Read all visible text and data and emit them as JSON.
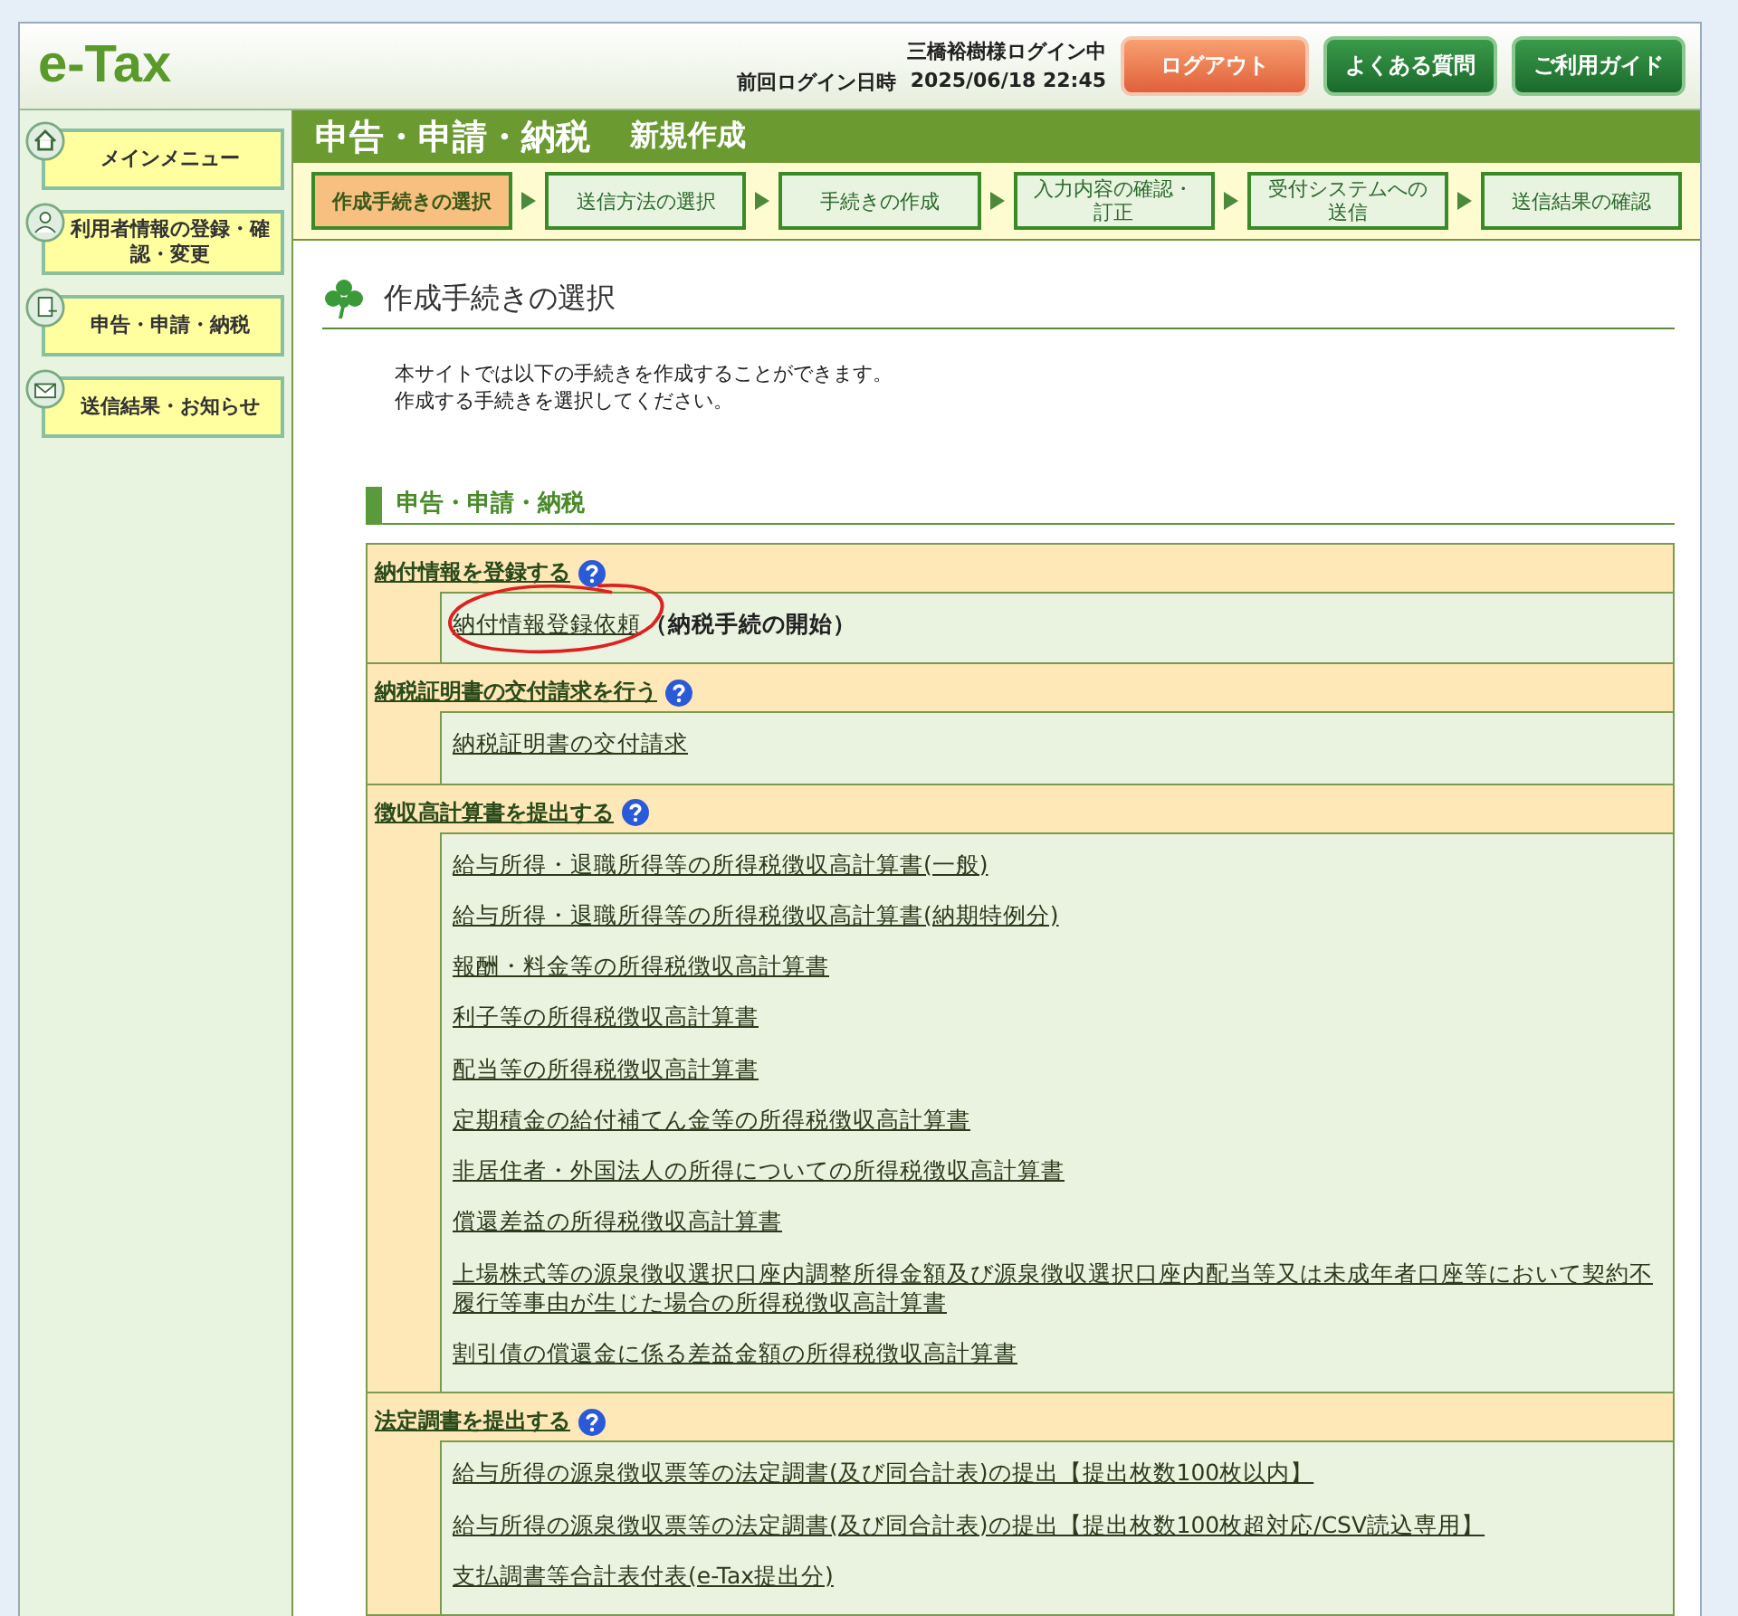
{
  "header": {
    "logo": "e-Tax",
    "user_status": "三橋裕樹様ログイン中",
    "last_login_label": "前回ログイン日時",
    "last_login_time": "2025/06/18 22:45",
    "buttons": [
      {
        "label": "ログアウト",
        "kind": "logout"
      },
      {
        "label": "よくある質問",
        "kind": "nav"
      },
      {
        "label": "ご利用ガイド",
        "kind": "nav"
      }
    ]
  },
  "sidebar": {
    "items": [
      {
        "label": "メインメニュー",
        "kind": "home"
      },
      {
        "label": "利用者情報の登録・確認・変更",
        "kind": "user"
      },
      {
        "label": "申告・申請・納税",
        "kind": "doc"
      },
      {
        "label": "送信結果・お知らせ",
        "kind": "mail"
      }
    ]
  },
  "title_bar": {
    "title": "申告・申請・納税",
    "subtitle": "新規作成"
  },
  "steps": [
    {
      "label": "作成手続きの選択",
      "selected": true
    },
    {
      "label": "送信方法の選択",
      "selected": false
    },
    {
      "label": "手続きの作成",
      "selected": false
    },
    {
      "label": "入力内容の確認・訂正",
      "selected": false
    },
    {
      "label": "受付システムへの送信",
      "selected": false
    },
    {
      "label": "送信結果の確認",
      "selected": false
    }
  ],
  "page_heading": "作成手続きの選択",
  "intro": [
    "本サイトでは以下の手続きを作成することができます。",
    "作成する手続きを選択してください。"
  ],
  "section_heading": "申告・申請・納税",
  "groups": [
    {
      "title": "納付情報を登録する",
      "items": [
        {
          "label": "納付情報登録依頼",
          "note": "（納税手続の開始）"
        }
      ]
    },
    {
      "title": "納税証明書の交付請求を行う",
      "items": [
        {
          "label": "納税証明書の交付請求"
        }
      ]
    },
    {
      "title": "徴収高計算書を提出する",
      "items": [
        {
          "label": "給与所得・退職所得等の所得税徴収高計算書(一般)"
        },
        {
          "label": "給与所得・退職所得等の所得税徴収高計算書(納期特例分)"
        },
        {
          "label": "報酬・料金等の所得税徴収高計算書"
        },
        {
          "label": "利子等の所得税徴収高計算書"
        },
        {
          "label": "配当等の所得税徴収高計算書"
        },
        {
          "label": "定期積金の給付補てん金等の所得税徴収高計算書"
        },
        {
          "label": "非居住者・外国法人の所得についての所得税徴収高計算書"
        },
        {
          "label": "償還差益の所得税徴収高計算書"
        },
        {
          "label": "上場株式等の源泉徴収選択口座内調整所得金額及び源泉徴収選択口座内配当等又は未成年者口座等において契約不履行等事由が生じた場合の所得税徴収高計算書"
        },
        {
          "label": "割引債の償還金に係る差益金額の所得税徴収高計算書"
        }
      ]
    },
    {
      "title": "法定調書を提出する",
      "items": [
        {
          "label": "給与所得の源泉徴収票等の法定調書(及び同合計表)の提出【提出枚数100枚以内】"
        },
        {
          "label": "給与所得の源泉徴収票等の法定調書(及び同合計表)の提出【提出枚数100枚超対応/CSV読込専用】"
        },
        {
          "label": "支払調書等合計表付表(e-Tax提出分)"
        }
      ]
    }
  ]
}
